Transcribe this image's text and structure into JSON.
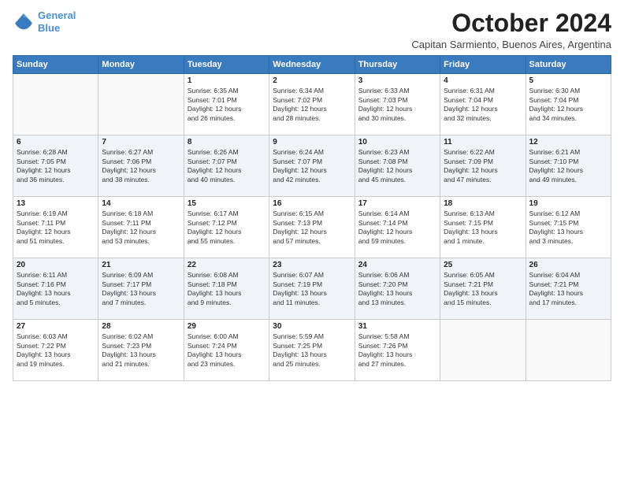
{
  "header": {
    "logo_line1": "General",
    "logo_line2": "Blue",
    "month": "October 2024",
    "location": "Capitan Sarmiento, Buenos Aires, Argentina"
  },
  "days_of_week": [
    "Sunday",
    "Monday",
    "Tuesday",
    "Wednesday",
    "Thursday",
    "Friday",
    "Saturday"
  ],
  "weeks": [
    [
      {
        "day": "",
        "detail": ""
      },
      {
        "day": "",
        "detail": ""
      },
      {
        "day": "1",
        "detail": "Sunrise: 6:35 AM\nSunset: 7:01 PM\nDaylight: 12 hours\nand 26 minutes."
      },
      {
        "day": "2",
        "detail": "Sunrise: 6:34 AM\nSunset: 7:02 PM\nDaylight: 12 hours\nand 28 minutes."
      },
      {
        "day": "3",
        "detail": "Sunrise: 6:33 AM\nSunset: 7:03 PM\nDaylight: 12 hours\nand 30 minutes."
      },
      {
        "day": "4",
        "detail": "Sunrise: 6:31 AM\nSunset: 7:04 PM\nDaylight: 12 hours\nand 32 minutes."
      },
      {
        "day": "5",
        "detail": "Sunrise: 6:30 AM\nSunset: 7:04 PM\nDaylight: 12 hours\nand 34 minutes."
      }
    ],
    [
      {
        "day": "6",
        "detail": "Sunrise: 6:28 AM\nSunset: 7:05 PM\nDaylight: 12 hours\nand 36 minutes."
      },
      {
        "day": "7",
        "detail": "Sunrise: 6:27 AM\nSunset: 7:06 PM\nDaylight: 12 hours\nand 38 minutes."
      },
      {
        "day": "8",
        "detail": "Sunrise: 6:26 AM\nSunset: 7:07 PM\nDaylight: 12 hours\nand 40 minutes."
      },
      {
        "day": "9",
        "detail": "Sunrise: 6:24 AM\nSunset: 7:07 PM\nDaylight: 12 hours\nand 42 minutes."
      },
      {
        "day": "10",
        "detail": "Sunrise: 6:23 AM\nSunset: 7:08 PM\nDaylight: 12 hours\nand 45 minutes."
      },
      {
        "day": "11",
        "detail": "Sunrise: 6:22 AM\nSunset: 7:09 PM\nDaylight: 12 hours\nand 47 minutes."
      },
      {
        "day": "12",
        "detail": "Sunrise: 6:21 AM\nSunset: 7:10 PM\nDaylight: 12 hours\nand 49 minutes."
      }
    ],
    [
      {
        "day": "13",
        "detail": "Sunrise: 6:19 AM\nSunset: 7:11 PM\nDaylight: 12 hours\nand 51 minutes."
      },
      {
        "day": "14",
        "detail": "Sunrise: 6:18 AM\nSunset: 7:11 PM\nDaylight: 12 hours\nand 53 minutes."
      },
      {
        "day": "15",
        "detail": "Sunrise: 6:17 AM\nSunset: 7:12 PM\nDaylight: 12 hours\nand 55 minutes."
      },
      {
        "day": "16",
        "detail": "Sunrise: 6:15 AM\nSunset: 7:13 PM\nDaylight: 12 hours\nand 57 minutes."
      },
      {
        "day": "17",
        "detail": "Sunrise: 6:14 AM\nSunset: 7:14 PM\nDaylight: 12 hours\nand 59 minutes."
      },
      {
        "day": "18",
        "detail": "Sunrise: 6:13 AM\nSunset: 7:15 PM\nDaylight: 13 hours\nand 1 minute."
      },
      {
        "day": "19",
        "detail": "Sunrise: 6:12 AM\nSunset: 7:15 PM\nDaylight: 13 hours\nand 3 minutes."
      }
    ],
    [
      {
        "day": "20",
        "detail": "Sunrise: 6:11 AM\nSunset: 7:16 PM\nDaylight: 13 hours\nand 5 minutes."
      },
      {
        "day": "21",
        "detail": "Sunrise: 6:09 AM\nSunset: 7:17 PM\nDaylight: 13 hours\nand 7 minutes."
      },
      {
        "day": "22",
        "detail": "Sunrise: 6:08 AM\nSunset: 7:18 PM\nDaylight: 13 hours\nand 9 minutes."
      },
      {
        "day": "23",
        "detail": "Sunrise: 6:07 AM\nSunset: 7:19 PM\nDaylight: 13 hours\nand 11 minutes."
      },
      {
        "day": "24",
        "detail": "Sunrise: 6:06 AM\nSunset: 7:20 PM\nDaylight: 13 hours\nand 13 minutes."
      },
      {
        "day": "25",
        "detail": "Sunrise: 6:05 AM\nSunset: 7:21 PM\nDaylight: 13 hours\nand 15 minutes."
      },
      {
        "day": "26",
        "detail": "Sunrise: 6:04 AM\nSunset: 7:21 PM\nDaylight: 13 hours\nand 17 minutes."
      }
    ],
    [
      {
        "day": "27",
        "detail": "Sunrise: 6:03 AM\nSunset: 7:22 PM\nDaylight: 13 hours\nand 19 minutes."
      },
      {
        "day": "28",
        "detail": "Sunrise: 6:02 AM\nSunset: 7:23 PM\nDaylight: 13 hours\nand 21 minutes."
      },
      {
        "day": "29",
        "detail": "Sunrise: 6:00 AM\nSunset: 7:24 PM\nDaylight: 13 hours\nand 23 minutes."
      },
      {
        "day": "30",
        "detail": "Sunrise: 5:59 AM\nSunset: 7:25 PM\nDaylight: 13 hours\nand 25 minutes."
      },
      {
        "day": "31",
        "detail": "Sunrise: 5:58 AM\nSunset: 7:26 PM\nDaylight: 13 hours\nand 27 minutes."
      },
      {
        "day": "",
        "detail": ""
      },
      {
        "day": "",
        "detail": ""
      }
    ]
  ]
}
